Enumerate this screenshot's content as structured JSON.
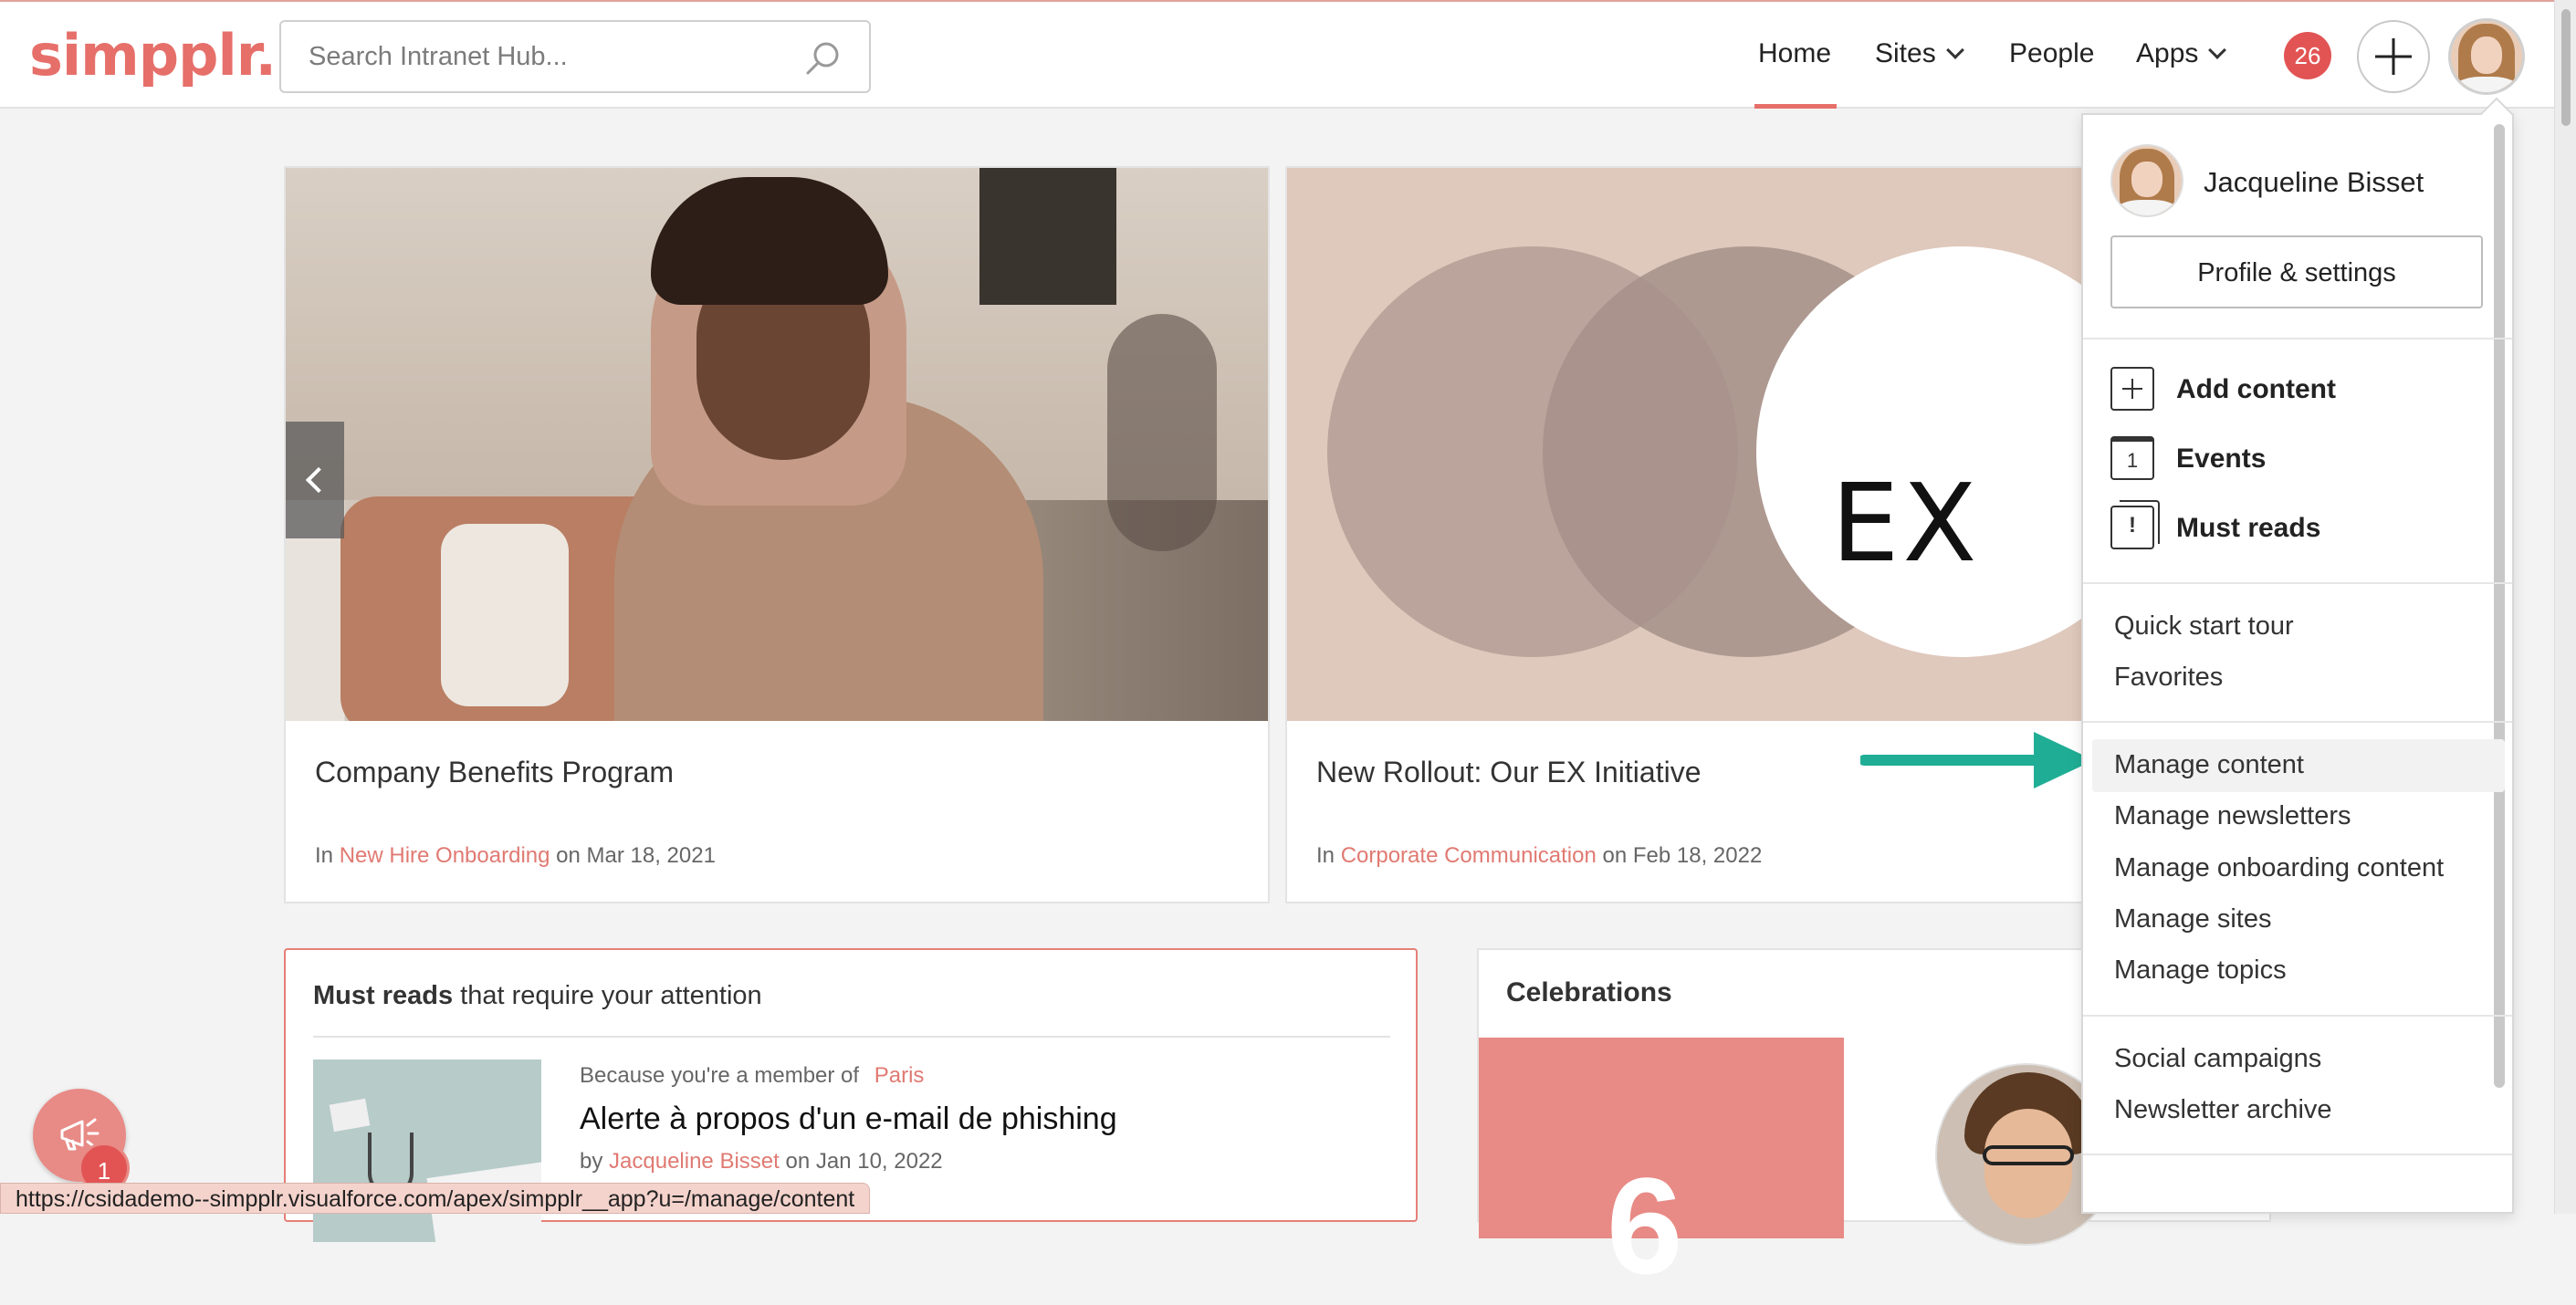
{
  "header": {
    "logo": "simpplr.",
    "search_placeholder": "Search Intranet Hub...",
    "nav": {
      "home": "Home",
      "sites": "Sites",
      "people": "People",
      "apps": "Apps"
    },
    "notifications_count": "26",
    "accent_color": "#e66f6a"
  },
  "carousel": [
    {
      "title": "Company Benefits Program",
      "in_label": "In",
      "site": "New Hire Onboarding",
      "on_label": "on",
      "date": "Mar 18, 2021"
    },
    {
      "title": "New Rollout: Our EX Initiative",
      "image_text": "EX",
      "in_label": "In",
      "site": "Corporate Communication",
      "on_label": "on",
      "date": "Feb 18, 2022"
    }
  ],
  "must_reads": {
    "title_bold": "Must reads",
    "title_rest": "that require your attention",
    "item": {
      "because": "Because you're a member of",
      "group": "Paris",
      "title": "Alerte à propos d'un e-mail de phishing",
      "by_label": "by",
      "author": "Jacqueline Bisset",
      "on_label": "on",
      "date": "Jan 10, 2022"
    }
  },
  "celebrations": {
    "title": "Celebrations",
    "number": "6"
  },
  "feedback": {
    "badge": "1",
    "icon": "megaphone-icon"
  },
  "status_bar": {
    "url": "https://csidademo--simpplr.visualforce.com/apex/simpplr__app?u=/manage/content"
  },
  "profile_menu": {
    "name": "Jacqueline Bisset",
    "profile_button": "Profile & settings",
    "actions": [
      {
        "label": "Add content",
        "icon": "add-content-icon"
      },
      {
        "label": "Events",
        "icon": "calendar-icon",
        "glyph": "1"
      },
      {
        "label": "Must reads",
        "icon": "must-reads-icon",
        "glyph": "!"
      }
    ],
    "links_group1": [
      "Quick start tour",
      "Favorites"
    ],
    "links_group2": [
      "Manage content",
      "Manage newsletters",
      "Manage onboarding content",
      "Manage sites",
      "Manage topics"
    ],
    "links_group3": [
      "Social campaigns",
      "Newsletter archive"
    ]
  }
}
